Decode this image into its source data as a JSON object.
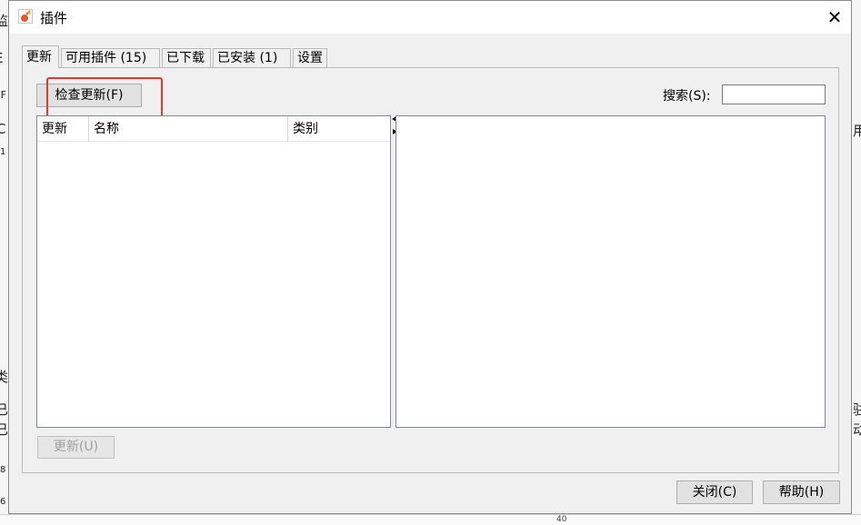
{
  "background": {
    "fragments_left": [
      "监",
      "E",
      "CF",
      "C",
      "1",
      "类",
      "已",
      "已",
      "8",
      "6"
    ],
    "fragments_right": [
      "用",
      "驻",
      "动"
    ],
    "bottom_tick": "40"
  },
  "dialog": {
    "title": "插件",
    "close_glyph": "✕"
  },
  "tabs": [
    {
      "label": "更新",
      "active": true
    },
    {
      "label": "可用插件 (15)",
      "active": false
    },
    {
      "label": "已下载",
      "active": false
    },
    {
      "label": "已安装 (1)",
      "active": false
    },
    {
      "label": "设置",
      "active": false
    }
  ],
  "panel": {
    "check_updates_label": "检查更新(F)",
    "search_label": "搜索(S):",
    "search_value": "",
    "table_columns": [
      "更新",
      "名称",
      "类别"
    ],
    "table_rows": [],
    "update_button_label": "更新(U)"
  },
  "footer": {
    "close_label": "关闭(C)",
    "help_label": "帮助(H)"
  },
  "colors": {
    "highlight": "#e53935",
    "dialog_bg": "#f0f0f0"
  }
}
